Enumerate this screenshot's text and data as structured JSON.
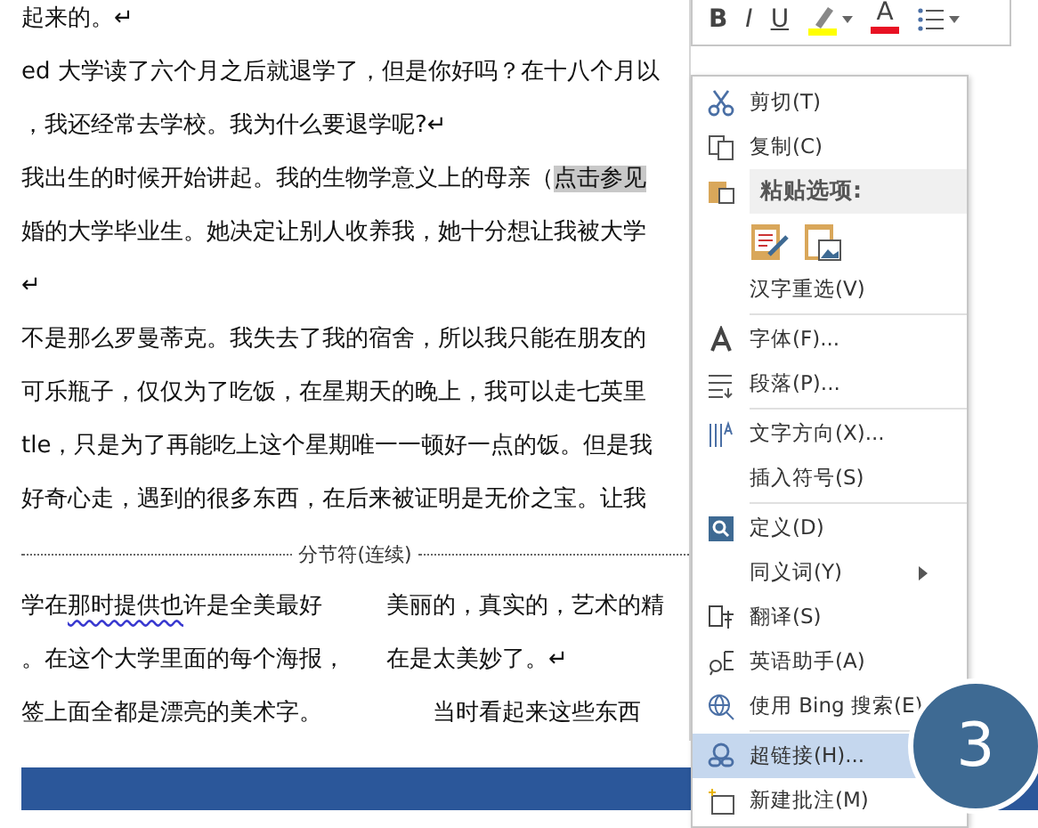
{
  "document": {
    "lines": [
      [
        {
          "text": "起来的。↵",
          "highlighted": false,
          "squiggle": false
        }
      ],
      [
        {
          "text": "ed 大学读了六个月之后就退学了，但是你好吗？在十八个月以",
          "highlighted": false,
          "squiggle": false
        }
      ],
      [
        {
          "text": "，我还经常去学校。我为什么要退学呢?↵",
          "highlighted": false,
          "squiggle": false
        }
      ],
      [
        {
          "text": "我出生的时候开始讲起。我的生物学意义上的母亲（",
          "highlighted": false,
          "squiggle": false
        },
        {
          "text": "点击参见",
          "highlighted": true,
          "squiggle": false
        }
      ],
      [
        {
          "text": "婚的大学毕业生。她决定让别人收养我，她十分想让我被大学",
          "highlighted": false,
          "squiggle": false
        }
      ],
      [
        {
          "text": "↵",
          "highlighted": false,
          "squiggle": false
        }
      ],
      [
        {
          "text": "不是那么罗曼蒂克。我失去了我的宿舍，所以我只能在朋友的",
          "highlighted": false,
          "squiggle": false
        }
      ],
      [
        {
          "text": "可乐瓶子，仅仅为了吃饭，在星期天的晚上，我可以走七英里",
          "highlighted": false,
          "squiggle": false
        }
      ],
      [
        {
          "text": "tle，只是为了再能吃上这个星期唯一一顿好一点的饭。但是我",
          "highlighted": false,
          "squiggle": false
        }
      ],
      [
        {
          "text": "好奇心走，遇到的很多东西，在后来被证明是无价之宝。让我",
          "highlighted": false,
          "squiggle": false
        }
      ]
    ],
    "section_break": "分节符(连续)",
    "left_column": [
      [
        {
          "text": "学在",
          "highlighted": false,
          "squiggle": false
        },
        {
          "text": "那时提供也",
          "highlighted": false,
          "squiggle": true
        },
        {
          "text": "许是全美最好",
          "highlighted": false,
          "squiggle": false
        }
      ],
      [
        {
          "text": "。在这个大学里面的每个海报，",
          "highlighted": false,
          "squiggle": false
        }
      ],
      [
        {
          "text": "签上面全都是漂亮的美术字。",
          "highlighted": false,
          "squiggle": false
        }
      ]
    ],
    "right_column": [
      [
        {
          "text": "美丽的，真实的，艺术的精",
          "highlighted": false,
          "squiggle": false
        }
      ],
      [
        {
          "text": "在是太美妙了。↵",
          "highlighted": false,
          "squiggle": false
        }
      ],
      [
        {
          "text": "　　当时看起来这些东西",
          "highlighted": false,
          "squiggle": false
        }
      ]
    ]
  },
  "mini_toolbar": [
    {
      "kind": "bold",
      "label": "B"
    },
    {
      "kind": "italic",
      "label": "I"
    },
    {
      "kind": "underline",
      "label": "U"
    },
    {
      "kind": "highlight",
      "color": "#ffff00"
    },
    {
      "kind": "font-color",
      "label": "A",
      "color": "#e81123"
    },
    {
      "kind": "bullets"
    }
  ],
  "context_menu": [
    {
      "kind": "item",
      "label": "剪切(T)",
      "selected": false,
      "has_submenu": false
    },
    {
      "kind": "item",
      "label": "复制(C)",
      "selected": false,
      "has_submenu": false
    },
    {
      "kind": "header",
      "label": "粘贴选项:"
    },
    {
      "kind": "paste-options"
    },
    {
      "kind": "item",
      "label": "汉字重选(V)",
      "selected": false,
      "has_submenu": false
    },
    {
      "kind": "separator"
    },
    {
      "kind": "item",
      "label": "字体(F)...",
      "selected": false,
      "has_submenu": false
    },
    {
      "kind": "item",
      "label": "段落(P)...",
      "selected": false,
      "has_submenu": false
    },
    {
      "kind": "separator"
    },
    {
      "kind": "item",
      "label": "文字方向(X)...",
      "selected": false,
      "has_submenu": false
    },
    {
      "kind": "item",
      "label": "插入符号(S)",
      "selected": false,
      "has_submenu": false
    },
    {
      "kind": "separator"
    },
    {
      "kind": "item",
      "label": "定义(D)",
      "selected": false,
      "has_submenu": false
    },
    {
      "kind": "item",
      "label": "同义词(Y)",
      "selected": false,
      "has_submenu": true
    },
    {
      "kind": "item",
      "label": "翻译(S)",
      "selected": false,
      "has_submenu": false
    },
    {
      "kind": "item",
      "label": "英语助手(A)",
      "selected": false,
      "has_submenu": false
    },
    {
      "kind": "item",
      "label": "使用 Bing 搜索(E)",
      "selected": false,
      "has_submenu": false
    },
    {
      "kind": "separator"
    },
    {
      "kind": "item",
      "label": "超链接(H)...",
      "selected": true,
      "has_submenu": false
    },
    {
      "kind": "item",
      "label": "新建批注(M)",
      "selected": false,
      "has_submenu": false
    }
  ],
  "step_badge": "3"
}
